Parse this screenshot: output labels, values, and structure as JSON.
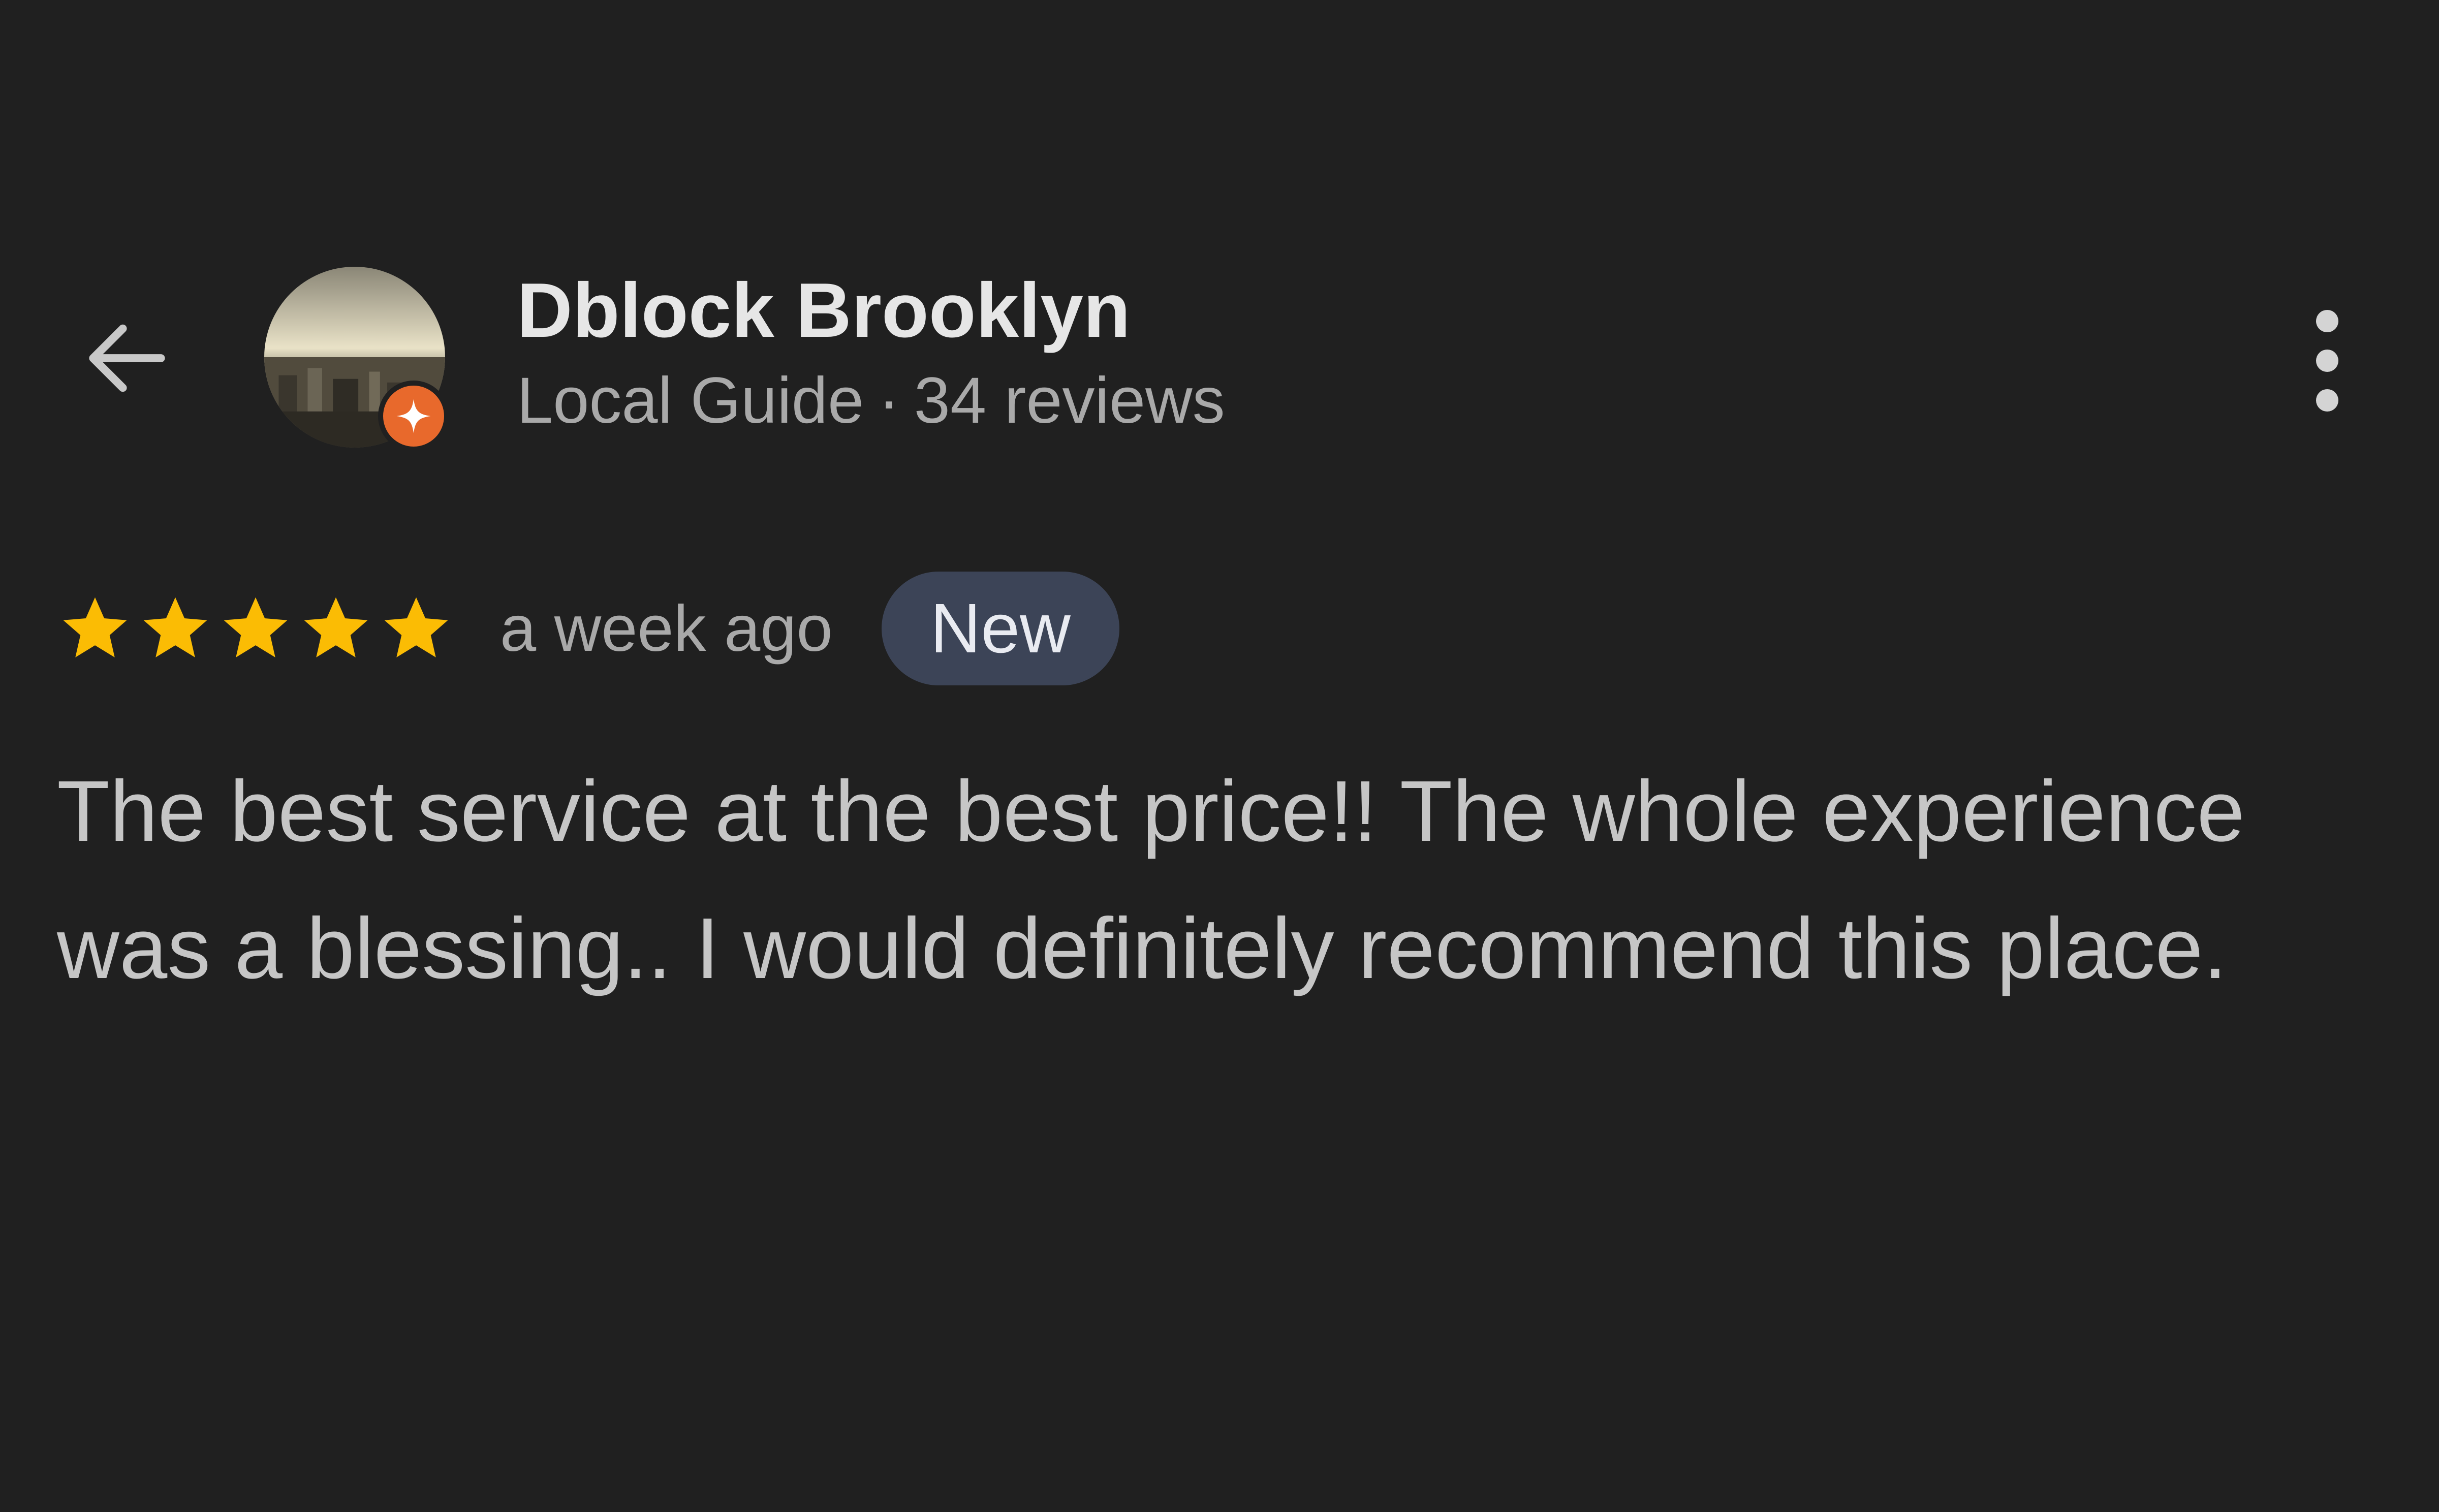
{
  "header": {
    "back_icon": "arrow-left-icon",
    "reviewer_name": "Dblock Brooklyn",
    "reviewer_level": "Local Guide",
    "separator": "·",
    "reviews_count": "34 reviews",
    "avatar_badge_icon": "local-guide-star-icon",
    "more_icon": "more-vertical-icon"
  },
  "rating": {
    "stars": 5,
    "max_stars": 5,
    "star_color": "#fbbc04",
    "time_ago": "a week ago",
    "badge": "New"
  },
  "review": {
    "text": "The best service at the best price!! The whole experience was a blessing.. I would definitely recommend this place."
  },
  "colors": {
    "background": "#202020",
    "badge_bg": "#3c4457",
    "guide_badge": "#e8692c"
  }
}
